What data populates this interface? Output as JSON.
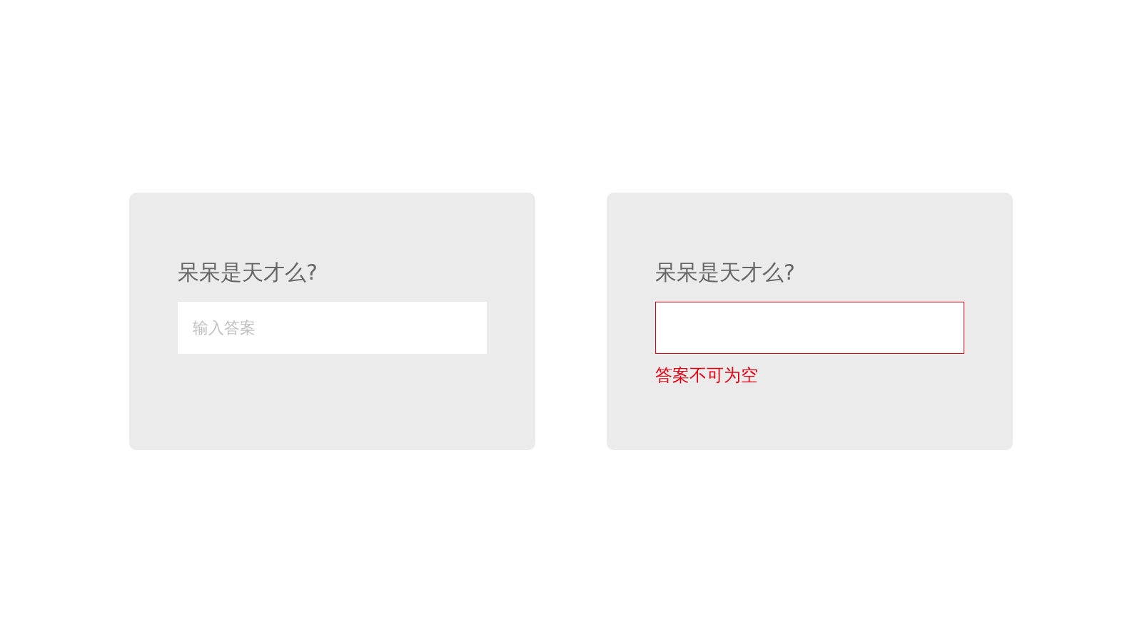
{
  "cards": [
    {
      "question": "呆呆是天才么?",
      "field": {
        "placeholder": "输入答案",
        "error": false
      }
    },
    {
      "question": "呆呆是天才么?",
      "field": {
        "error": true,
        "message": "答案不可为空"
      }
    }
  ]
}
